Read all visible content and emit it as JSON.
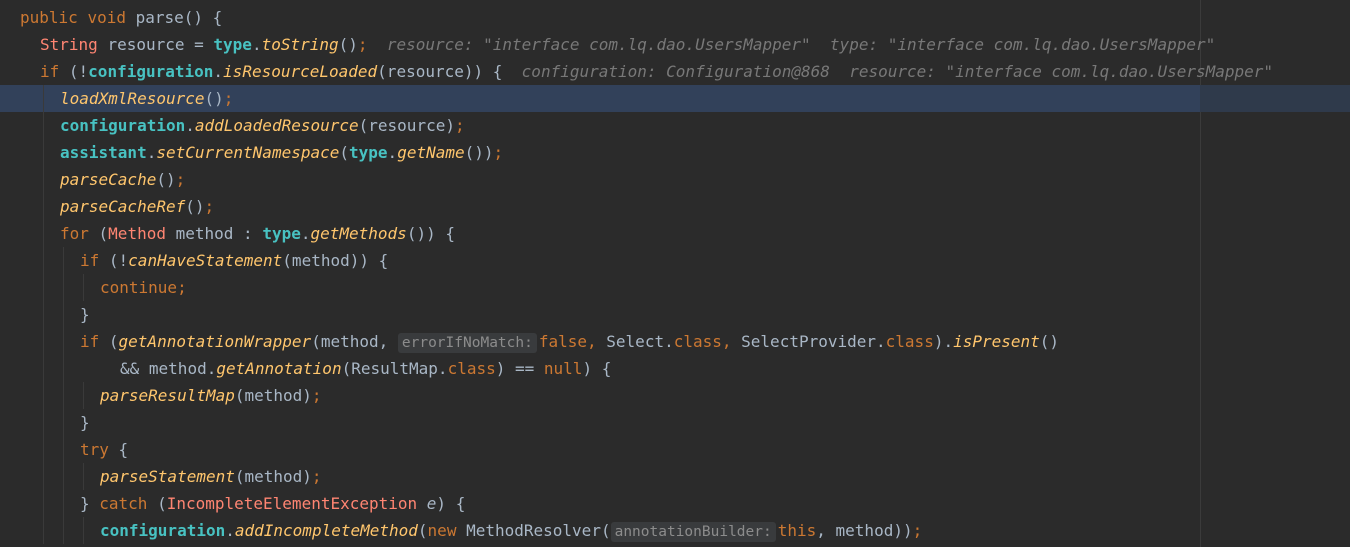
{
  "code": {
    "l1": {
      "kw1": "public",
      "kw2": "void",
      "name": "parse",
      "tail": "() {"
    },
    "l2": {
      "type": "String",
      "var": "resource",
      "eq": " = ",
      "obj": "type",
      "dot": ".",
      "call": "toString",
      "paren": "()",
      "semi": ";",
      "inline": "resource: \"interface com.lq.dao.UsersMapper\"  type: \"interface com.lq.dao.UsersMapper\""
    },
    "l3": {
      "kw": "if",
      "open": " (!",
      "obj": "configuration",
      "dot": ".",
      "call": "isResourceLoaded",
      "args": "(resource)) {",
      "inline": "configuration: Configuration@868  resource: \"interface com.lq.dao.UsersMapper\""
    },
    "l4": {
      "call": "loadXmlResource",
      "paren": "()",
      "semi": ";"
    },
    "l5": {
      "obj": "configuration",
      "dot": ".",
      "call": "addLoadedResource",
      "args": "(resource)",
      "semi": ";"
    },
    "l6": {
      "obj": "assistant",
      "dot": ".",
      "call": "setCurrentNamespace",
      "open": "(",
      "obj2": "type",
      "dot2": ".",
      "call2": "getName",
      "close": "())",
      "semi": ";"
    },
    "l7": {
      "call": "parseCache",
      "paren": "()",
      "semi": ";"
    },
    "l8": {
      "call": "parseCacheRef",
      "paren": "()",
      "semi": ";"
    },
    "l9": {
      "kw": "for",
      "open": " (",
      "type": "Method",
      "var": " method",
      "colon": " : ",
      "obj": "type",
      "dot": ".",
      "call": "getMethods",
      "close": "()) {"
    },
    "l10": {
      "kw": "if",
      "open": " (!",
      "call": "canHaveStatement",
      "args": "(method)) {"
    },
    "l11": {
      "kw": "continue",
      "semi": ";"
    },
    "l12": {
      "brace": "}"
    },
    "l13": {
      "kw": "if",
      "open": " (",
      "call": "getAnnotationWrapper",
      "args1": "(method, ",
      "hint": "errorIfNoMatch:",
      "val": "false",
      "comma1": ", ",
      "cls1": "Select",
      "dot1": ".",
      "kwclass1": "class",
      "comma2": ", ",
      "cls2": "SelectProvider",
      "dot2": ".",
      "kwclass2": "class",
      "close": ").",
      "call2": "isPresent",
      "paren": "()"
    },
    "l14": {
      "op": "&& ",
      "obj": "method",
      "dot": ".",
      "call": "getAnnotation",
      "open": "(",
      "cls": "ResultMap",
      "dot2": ".",
      "kwclass": "class",
      "mid": ") == ",
      "kwnull": "null",
      "close": ") {"
    },
    "l15": {
      "call": "parseResultMap",
      "args": "(method)",
      "semi": ";"
    },
    "l16": {
      "brace": "}"
    },
    "l17": {
      "kw": "try",
      "tail": " {"
    },
    "l18": {
      "call": "parseStatement",
      "args": "(method)",
      "semi": ";"
    },
    "l19": {
      "brace": "} ",
      "kw": "catch",
      "open": " (",
      "type": "IncompleteElementException",
      "var": " e",
      "close": ") {"
    },
    "l20": {
      "obj": "configuration",
      "dot": ".",
      "call": "addIncompleteMethod",
      "open": "(",
      "kw": "new",
      "cls": " MethodResolver",
      "paren": "(",
      "hint": "annotationBuilder:",
      "kwthis": "this",
      "tail": ", method))",
      "semi": ";"
    }
  }
}
